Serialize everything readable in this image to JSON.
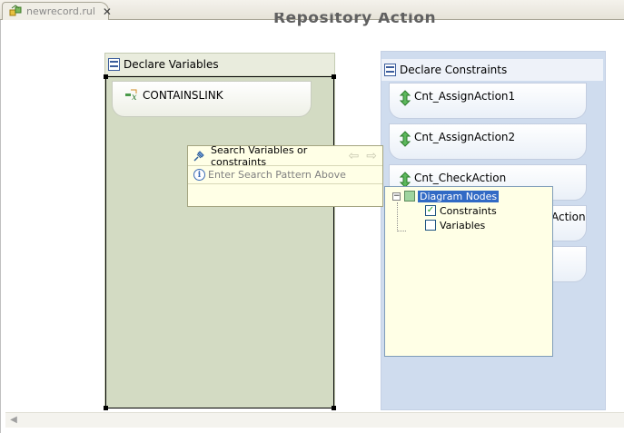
{
  "tab": {
    "label": "newrecord.rul",
    "close": "✕"
  },
  "diagram": {
    "title": "Repository Action"
  },
  "variables_panel": {
    "title": "Declare Variables",
    "nodes": [
      {
        "label": "CONTAINSLINK"
      }
    ]
  },
  "constraints_panel": {
    "title": "Declare Constraints",
    "nodes": [
      {
        "label": "Cnt_AssignAction1"
      },
      {
        "label": "Cnt_AssignAction2"
      },
      {
        "label": "Cnt_CheckAction"
      },
      {
        "label": ""
      },
      {
        "label": ""
      }
    ],
    "hidden_tail": "Action"
  },
  "search_popup": {
    "title": "Search Variables or constraints",
    "placeholder": "Enter Search Pattern Above",
    "back_arrow": "⇦",
    "forward_arrow": "⇨"
  },
  "tree_popup": {
    "root": {
      "label": "Diagram Nodes",
      "expanded": true
    },
    "children": [
      {
        "label": "Constraints",
        "checked": true
      },
      {
        "label": "Variables",
        "checked": false
      }
    ]
  }
}
